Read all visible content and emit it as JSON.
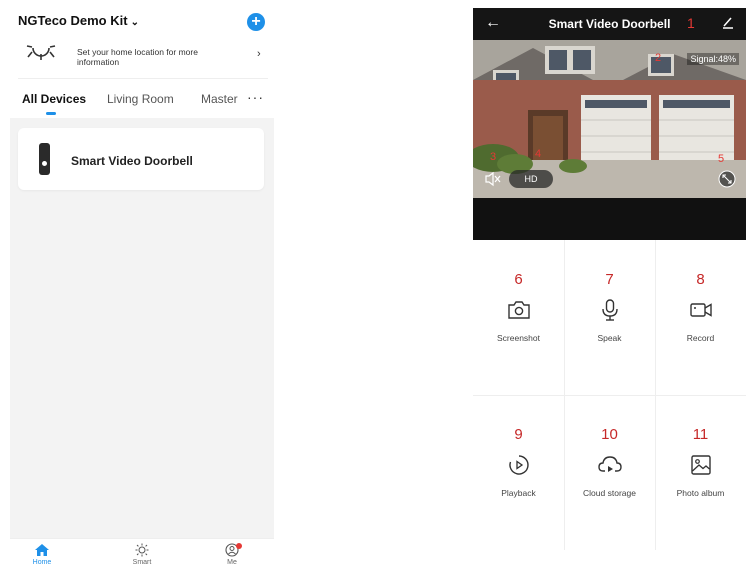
{
  "left_phone": {
    "home_title": "NGTeco Demo Kit",
    "home_title_chevron": "⌄",
    "add_symbol": "+",
    "location_prompt": "Set your home location for more information",
    "location_arrow": "›",
    "tabs": [
      {
        "label": "All Devices",
        "active": true
      },
      {
        "label": "Living Room",
        "active": false
      },
      {
        "label": "Master",
        "active": false
      }
    ],
    "more_symbol": "···",
    "devices": [
      {
        "name": "Smart Video Doorbell",
        "icon": "doorbell-icon"
      }
    ],
    "bottom_nav": [
      {
        "label": "Home",
        "icon": "home-icon",
        "active": true
      },
      {
        "label": "Smart",
        "icon": "sun-icon",
        "active": false
      },
      {
        "label": "Me",
        "icon": "profile-icon",
        "active": false,
        "badge": true
      }
    ],
    "colors": {
      "accent": "#1e90e8",
      "badge": "#e53935",
      "background": "#f3f3f3"
    }
  },
  "right_phone": {
    "title": "Smart Video Doorbell",
    "back_symbol": "←",
    "signal_text": "Signal:48%",
    "hd_label": "HD",
    "callouts": {
      "n1": "1",
      "n2": "2",
      "n3": "3",
      "n4": "4",
      "n5": "5"
    },
    "actions": [
      {
        "number": "6",
        "label": "Screenshot",
        "icon": "camera-icon"
      },
      {
        "number": "7",
        "label": "Speak",
        "icon": "microphone-icon"
      },
      {
        "number": "8",
        "label": "Record",
        "icon": "video-camera-icon"
      },
      {
        "number": "9",
        "label": "Playback",
        "icon": "playback-icon"
      },
      {
        "number": "10",
        "label": "Cloud storage",
        "icon": "cloud-icon"
      },
      {
        "number": "11",
        "label": "Photo album",
        "icon": "photo-album-icon"
      }
    ],
    "colors": {
      "header": "#151515",
      "callout": "#c62828"
    }
  }
}
